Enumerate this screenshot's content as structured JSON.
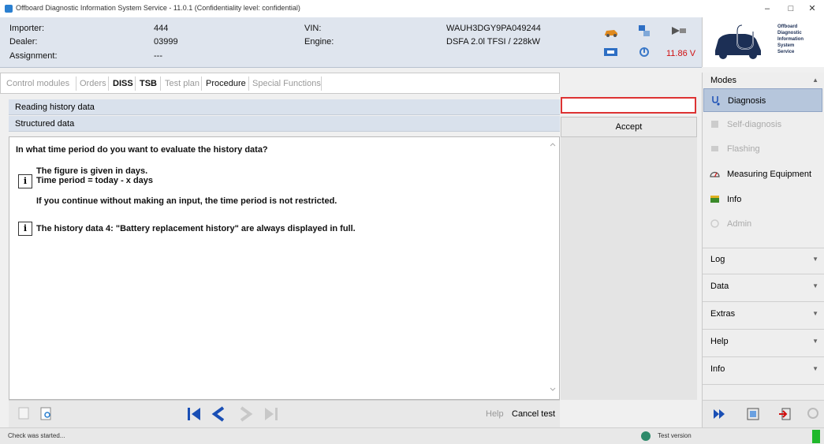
{
  "window": {
    "title": "Offboard Diagnostic Information System Service - 11.0.1 (Confidentiality level: confidential)",
    "minimize": "–",
    "maximize": "□",
    "close": "✕"
  },
  "header": {
    "importer_label": "Importer:",
    "importer_value": "444",
    "dealer_label": "Dealer:",
    "dealer_value": "03999",
    "assignment_label": "Assignment:",
    "assignment_value": "---",
    "vin_label": "VIN:",
    "vin_value": "WAUH3DGY9PA049244",
    "engine_label": "Engine:",
    "engine_value": "DSFA 2.0l TFSI / 228kW",
    "voltage": "11.86 V"
  },
  "logo": {
    "lines": [
      "Offboard",
      "Diagnostic",
      "Information",
      "System",
      "Service"
    ]
  },
  "tabs": [
    {
      "label": "Control modules",
      "state": "disabled"
    },
    {
      "label": "Orders",
      "state": "disabled"
    },
    {
      "label": "DISS",
      "state": "bold"
    },
    {
      "label": "TSB",
      "state": "bold"
    },
    {
      "label": "Test plan",
      "state": "disabled"
    },
    {
      "label": "Procedure",
      "state": "active"
    },
    {
      "label": "Special Functions",
      "state": "disabled"
    }
  ],
  "nav": {
    "reading_history": "Reading history data",
    "structured_data": "Structured data"
  },
  "content": {
    "question": "In what time period do you want to evaluate the history data?",
    "info1_line1": "The figure is given in days.",
    "info1_line2": "Time period = today - x days",
    "info1_line3": "If you continue without making an input, the time period is not restricted.",
    "info2": "The history data 4: \"Battery replacement history\" are always displayed in full.",
    "info_glyph": "i"
  },
  "input": {
    "value": "",
    "accept_label": "Accept"
  },
  "bottom": {
    "help_label": "Help",
    "cancel_label": "Cancel test"
  },
  "sidebar": {
    "modes_label": "Modes",
    "modes": [
      {
        "label": "Diagnosis",
        "state": "selected"
      },
      {
        "label": "Self-diagnosis",
        "state": "disabled"
      },
      {
        "label": "Flashing",
        "state": "disabled"
      },
      {
        "label": "Measuring Equipment",
        "state": "enabled"
      },
      {
        "label": "Info",
        "state": "enabled"
      },
      {
        "label": "Admin",
        "state": "disabled"
      }
    ],
    "sections": [
      "Log",
      "Data",
      "Extras",
      "Help",
      "Info"
    ]
  },
  "status": {
    "left": "Check was started...",
    "test_version": "Test version"
  },
  "colors": {
    "header_bg": "#dfe5ee",
    "accent_blue": "#1a4fb5",
    "voltage_red": "#d01010",
    "selected_mode": "#b6c6dc"
  }
}
